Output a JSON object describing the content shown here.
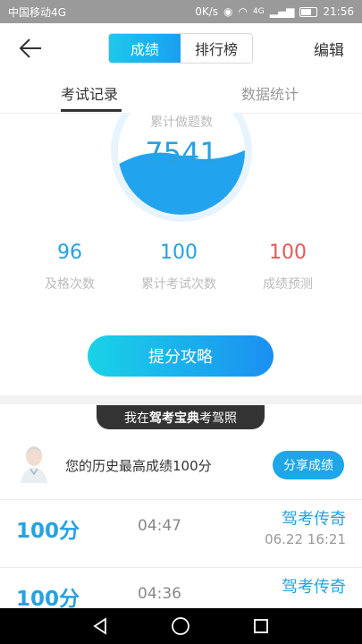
{
  "status_bar": {
    "carrier": "中国移动4G",
    "speed": "0K/s",
    "network": "4G",
    "time": "21:56"
  },
  "header": {
    "tab_score": "成绩",
    "tab_rank": "排行榜",
    "edit": "编辑"
  },
  "tabs": {
    "records": "考试记录",
    "stats": "数据统计"
  },
  "summary": {
    "total_label": "累计做题数",
    "total_value": "7541",
    "pass_count": "96",
    "pass_label": "及格次数",
    "exam_count": "100",
    "exam_label": "累计考试次数",
    "predict": "100",
    "predict_label": "成绩预测"
  },
  "strategy_button": "提分攻略",
  "banner": {
    "prefix": "我在",
    "brand": "驾考宝典",
    "suffix": "考驾照"
  },
  "best": {
    "text": "您的历史最高成绩100分",
    "share": "分享成绩"
  },
  "records": [
    {
      "score": "100分",
      "duration": "04:47",
      "rank": "驾考传奇",
      "date": "06.22  16:21"
    },
    {
      "score": "100分",
      "duration": "04:36",
      "rank": "驾考传奇",
      "date": ""
    }
  ],
  "colors": {
    "accent": "#27a2e0",
    "predict": "#e35a5a"
  }
}
